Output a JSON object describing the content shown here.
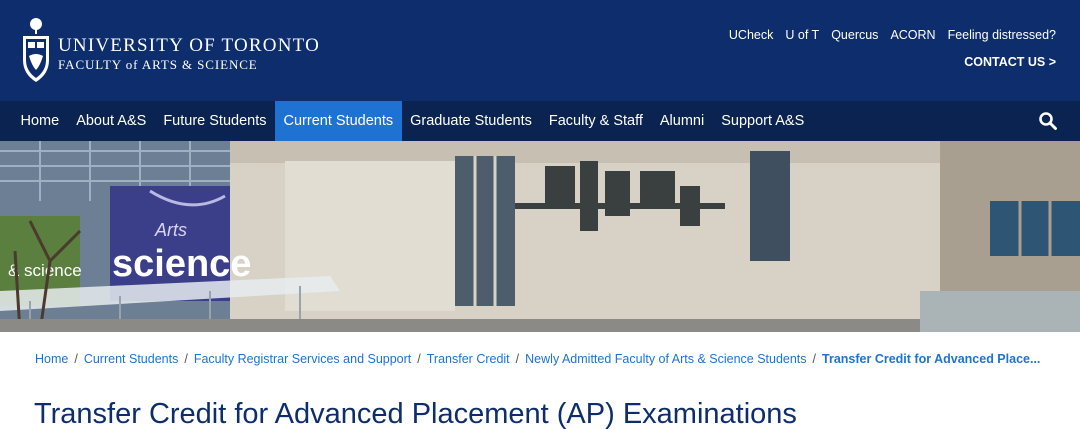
{
  "header": {
    "university_name": "UNIVERSITY OF TORONTO",
    "faculty_name": "FACULTY of ARTS & SCIENCE",
    "utility_links": [
      {
        "label": "UCheck"
      },
      {
        "label": "U of T"
      },
      {
        "label": "Quercus"
      },
      {
        "label": "ACORN"
      },
      {
        "label": "Feeling distressed?"
      }
    ],
    "contact_label": "CONTACT US >"
  },
  "nav": {
    "items": [
      {
        "label": "Home"
      },
      {
        "label": "About A&S"
      },
      {
        "label": "Future Students"
      },
      {
        "label": "Current Students",
        "active": true
      },
      {
        "label": "Graduate Students"
      },
      {
        "label": "Faculty & Staff"
      },
      {
        "label": "Alumni"
      },
      {
        "label": "Support A&S"
      }
    ],
    "search_icon": "search-icon"
  },
  "hero": {
    "sign_line1": "Arts",
    "sign_line2": "science",
    "left_sign": "& science"
  },
  "breadcrumb": {
    "items": [
      {
        "label": "Home"
      },
      {
        "label": "Current Students"
      },
      {
        "label": "Faculty Registrar Services and Support"
      },
      {
        "label": "Transfer Credit"
      },
      {
        "label": "Newly Admitted Faculty of Arts & Science Students"
      }
    ],
    "current": "Transfer Credit for Advanced Place..."
  },
  "page": {
    "title": "Transfer Credit for Advanced Placement (AP) Examinations"
  },
  "colors": {
    "header_bg": "#0d2d6c",
    "nav_bg": "#0a2350",
    "nav_active": "#1e73d2",
    "link": "#1e73d2"
  }
}
